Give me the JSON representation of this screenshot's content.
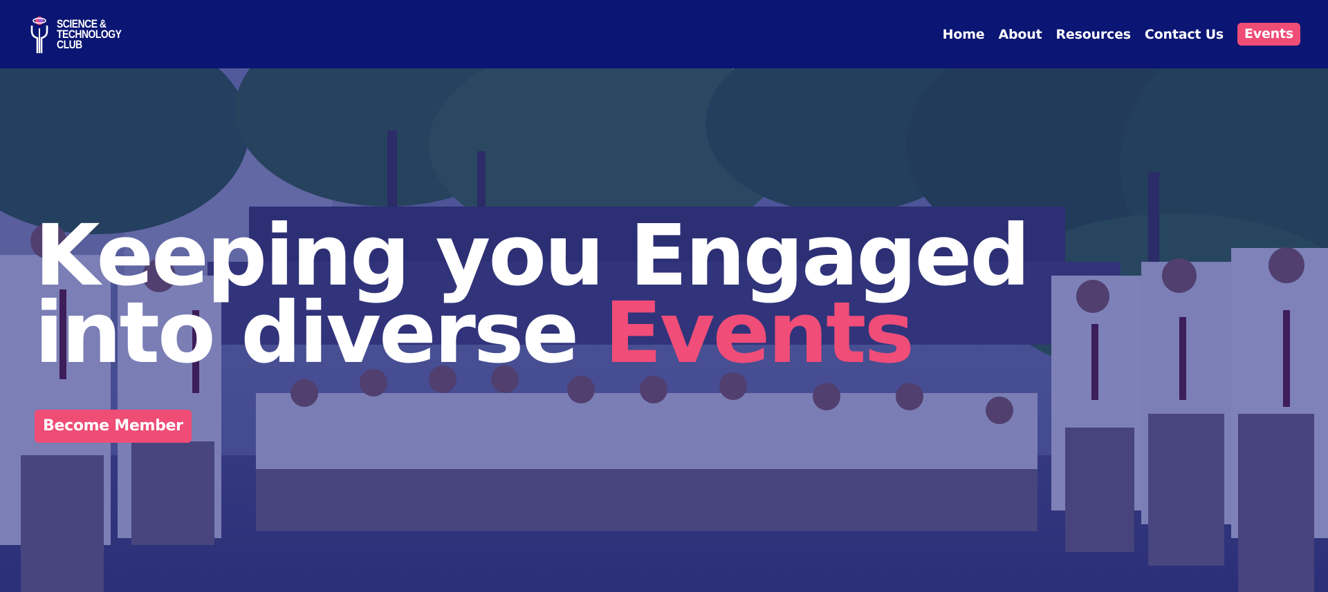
{
  "brand": {
    "line1": "SCIENCE &",
    "line2": "TECHNOLOGY",
    "line3": "CLUB",
    "icon": "atom-tuning-fork-logo"
  },
  "nav": {
    "items": [
      {
        "label": "Home",
        "active": false
      },
      {
        "label": "About",
        "active": false
      },
      {
        "label": "Resources",
        "active": false
      },
      {
        "label": "Contact Us",
        "active": false
      },
      {
        "label": "Events",
        "active": true
      }
    ]
  },
  "hero": {
    "headline_line1": "Keeping you Engaged",
    "headline_line2_prefix": "into diverse ",
    "headline_line2_accent": "Events",
    "cta_label": "Become Member",
    "background_description": "group photo of students in uniform outdoors with trees"
  },
  "colors": {
    "navbar": "#0b1573",
    "accent": "#ef4c76",
    "text": "#ffffff",
    "overlay": "#161a78"
  }
}
